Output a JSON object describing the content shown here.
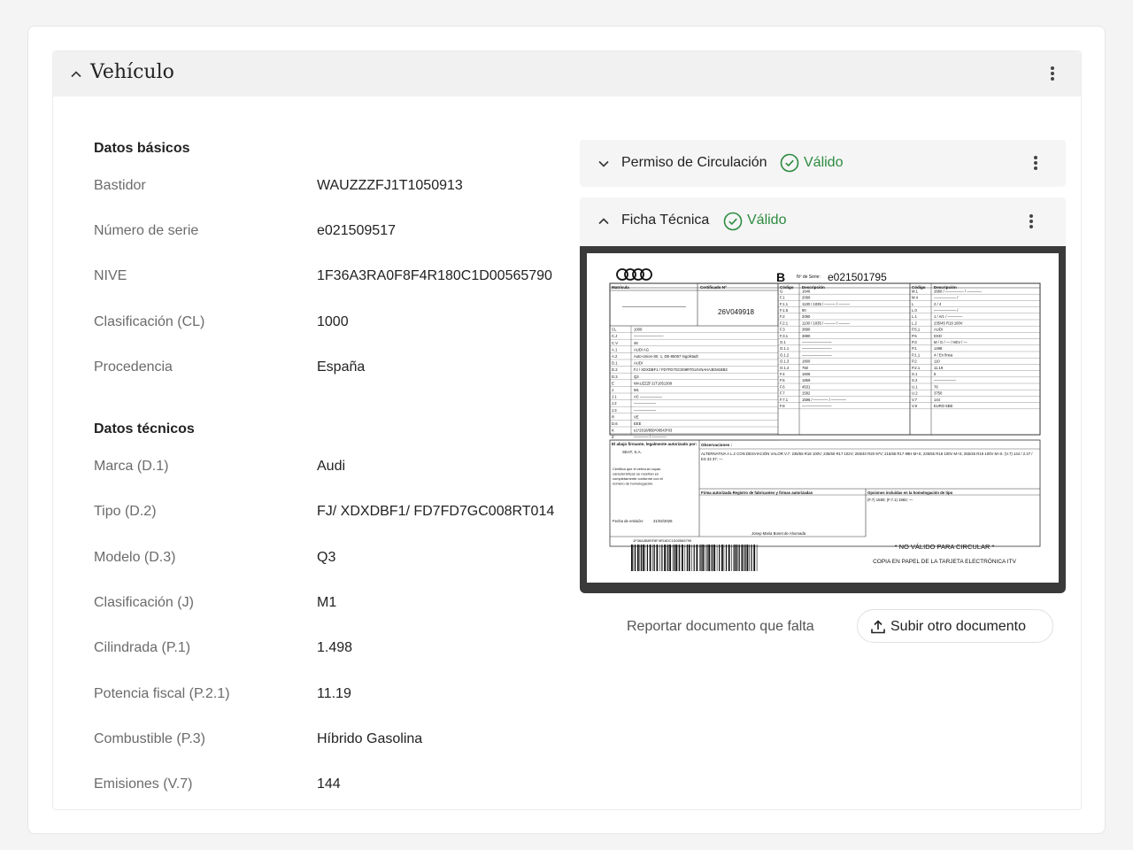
{
  "section": {
    "title": "Vehículo"
  },
  "basic": {
    "title": "Datos básicos",
    "rows": [
      {
        "label": "Bastidor",
        "value": "WAUZZZFJ1T1050913"
      },
      {
        "label": "Número de serie",
        "value": "e021509517"
      },
      {
        "label": "NIVE",
        "value": "1F36A3RA0F8F4R180C1D00565790"
      },
      {
        "label": "Clasificación (CL)",
        "value": "1000"
      },
      {
        "label": "Procedencia",
        "value": "España"
      }
    ]
  },
  "technical": {
    "title": "Datos técnicos",
    "rows": [
      {
        "label": "Marca (D.1)",
        "value": "Audi"
      },
      {
        "label": "Tipo (D.2)",
        "value": "FJ/ XDXDBF1/ FD7FD7GC008RT014"
      },
      {
        "label": "Modelo (D.3)",
        "value": "Q3"
      },
      {
        "label": "Clasificación (J)",
        "value": "M1"
      },
      {
        "label": "Cilindrada (P.1)",
        "value": "1.498"
      },
      {
        "label": "Potencia fiscal (P.2.1)",
        "value": "11.19"
      },
      {
        "label": "Combustible (P.3)",
        "value": "Híbrido Gasolina"
      },
      {
        "label": "Emisiones (V.7)",
        "value": "144"
      }
    ]
  },
  "documents": [
    {
      "name": "Permiso de Circulación",
      "status": "Válido",
      "status_color": "#2b8a3e",
      "expanded": false
    },
    {
      "name": "Ficha Técnica",
      "status": "Válido",
      "status_color": "#2b8a3e",
      "expanded": true
    }
  ],
  "preview": {
    "letter": "B",
    "serie_label": "Nº de Serie:",
    "serie_value": "e021501795",
    "matricula_label": "Matrícula",
    "certificado_label": "Certificado Nº",
    "certificado_value": "26V049918",
    "codigo_label": "Código",
    "descripcion_label": "Descripción",
    "observaciones_label": "Observaciones :",
    "observaciones_text": "ALTERNATIVA A L.2 CON DESVIACIÓN VALOR V.7: 235/55 R18 100V; 235/60 R17 102V; 255/40 R20 97V; 215/65 R17 99H M+S; 235/55 R18 100V M+S; 255/45 R19 100V M+S. (V.7) 144 / 2.27 / ES 32 37; —",
    "firmante_label": "El abajo firmante, legalmente autorizado por:",
    "firmante_value": "SEAT, S.A.",
    "certifica_text": "Certifica que el vehículo cuyas características se reseñan es completamente conforme con el número de homologación.",
    "fecha_label": "Fecha de emisión:",
    "fecha_value": "21/02/2026",
    "firma_label": "Firma autorizada Registro de fabricantes y firmas autorizadas",
    "opciones_label": "Opciones incluidas en la homologación de tipo",
    "opciones_value": "(F.7) 1580; (F.7.1) 1582; —",
    "firmante_name": "Josep Maria Bonet de Ahumada",
    "barcode_text": "1F36A3B8SF8F4R180C1D00565799",
    "no_valido": "* NO VÁLIDO PARA CIRCULAR *",
    "copia": "COPIA EN PAPEL DE LA TARJETA ELECTRÓNICA ITV",
    "left_codes": [
      "CL",
      "C.J",
      "C.V",
      "A.1",
      "A.2",
      "D.1",
      "D.2",
      "D.3",
      "E",
      "J",
      "J.1",
      "J.2",
      "J.3",
      "R",
      "D.6",
      "K",
      "Z"
    ],
    "left_values": [
      "1000",
      "————————",
      "46",
      "AUDI AG",
      "Auto-Union-Str. 1, DE-85057 Ingolstadt",
      "AUDI",
      "FJ / XDXDBF1 / FD7FD7GC008RT014VNAHA3EM1BB2",
      "Q3",
      "WAUZZZFJ1T1051309",
      "M1",
      "AC ——————",
      "——————",
      "——————",
      "VE",
      "EEE",
      "e1*2018/858*00543*03",
      "———— / ————"
    ],
    "mid_codes": [
      "G",
      "F.1",
      "F.1.1",
      "F.1.5",
      "F.2",
      "F.2.1",
      "F.3",
      "F.3.1",
      "O.1",
      "O.1.1",
      "O.1.2",
      "O.1.3",
      "O.1.4",
      "F.4",
      "F.5",
      "F.6",
      "F.7",
      "F.7.1",
      "F.8"
    ],
    "mid_values": [
      "1646",
      "2090",
      "1130 / 1035 / ——— / ———",
      "90",
      "2090",
      "1130 / 1035 / ——— / ———",
      "3890",
      "3890",
      "————————",
      "————————",
      "————————",
      "1800",
      "750",
      "1606",
      "1859",
      "4531",
      "1582",
      "1596 / ———— / ————",
      "————————"
    ],
    "right_codes": [
      "M.1",
      "M.4",
      "L",
      "L.0",
      "L.1",
      "L.2",
      "P.5.1",
      "P.5",
      "P.3",
      "P.1",
      "P.1.1",
      "P.2",
      "P.2.1",
      "S.1",
      "S.2",
      "U.1",
      "U.2",
      "V.7",
      "V.9"
    ],
    "right_values": [
      "2680 / ————— / ————",
      "—————— /",
      "2 / 4",
      "—————— /",
      "1 / Art. / ————",
      "235/45 R19 100V",
      "AUDI",
      "DXD",
      "M / G / — / HEV / —",
      "1498",
      "4 / En línea",
      "110",
      "11.19",
      "5",
      "——————",
      "76",
      "3750",
      "144",
      "EURO 6EB"
    ]
  },
  "actions": {
    "report_label": "Reportar documento que falta",
    "upload_label": "Subir otro documento"
  }
}
